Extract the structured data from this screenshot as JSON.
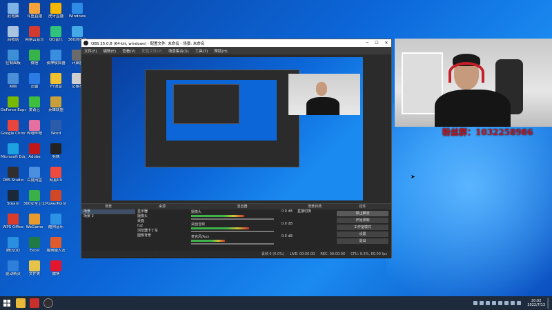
{
  "desktop_icons": [
    {
      "label": "此电脑",
      "color": "#7fb3e6",
      "col": 0,
      "row": 0
    },
    {
      "label": "回收站",
      "color": "#a9c4e0",
      "col": 0,
      "row": 1
    },
    {
      "label": "控制面板",
      "color": "#3d8fd6",
      "col": 0,
      "row": 2
    },
    {
      "label": "网络",
      "color": "#4a90d9",
      "col": 0,
      "row": 3
    },
    {
      "label": "GeForce Experience",
      "color": "#76b900",
      "col": 0,
      "row": 4
    },
    {
      "label": "Google Chrome",
      "color": "#e8453c",
      "col": 0,
      "row": 5
    },
    {
      "label": "Microsoft Edge",
      "color": "#1da1e0",
      "col": 0,
      "row": 6
    },
    {
      "label": "OBS Studio",
      "color": "#302e31",
      "col": 0,
      "row": 7
    },
    {
      "label": "Steam",
      "color": "#1b2838",
      "col": 0,
      "row": 8
    },
    {
      "label": "WPS Office",
      "color": "#d93c2a",
      "col": 0,
      "row": 9
    },
    {
      "label": "腾讯QQ",
      "color": "#2a8fe0",
      "col": 0,
      "row": 10
    },
    {
      "label": "驱动精灵",
      "color": "#2e7fd9",
      "col": 0,
      "row": 11
    },
    {
      "label": "斗鱼直播",
      "color": "#f6a23a",
      "col": 1,
      "row": 0
    },
    {
      "label": "网易云音乐",
      "color": "#d33a31",
      "col": 1,
      "row": 1
    },
    {
      "label": "微信",
      "color": "#36b44a",
      "col": 1,
      "row": 2
    },
    {
      "label": "迅雷",
      "color": "#2b7be4",
      "col": 1,
      "row": 3
    },
    {
      "label": "爱奇艺",
      "color": "#3dbf3d",
      "col": 1,
      "row": 4
    },
    {
      "label": "哔哩哔哩",
      "color": "#e56f9e",
      "col": 1,
      "row": 5
    },
    {
      "label": "Adobe",
      "color": "#c01818",
      "col": 1,
      "row": 6
    },
    {
      "label": "百度网盘",
      "color": "#4a8fe0",
      "col": 1,
      "row": 7
    },
    {
      "label": "360安全卫士",
      "color": "#3ab049",
      "col": 1,
      "row": 8
    },
    {
      "label": "WeGame",
      "color": "#e89b2c",
      "col": 1,
      "row": 9
    },
    {
      "label": "Excel",
      "color": "#1f7a45",
      "col": 1,
      "row": 10
    },
    {
      "label": "文件夹",
      "color": "#e7c34a",
      "col": 1,
      "row": 11
    },
    {
      "label": "虎牙直播",
      "color": "#f5b700",
      "col": 2,
      "row": 0
    },
    {
      "label": "QQ音乐",
      "color": "#31c27c",
      "col": 2,
      "row": 1
    },
    {
      "label": "夜神模拟器",
      "color": "#3a8ee0",
      "col": 2,
      "row": 2
    },
    {
      "label": "YY语音",
      "color": "#f2c12e",
      "col": 2,
      "row": 3
    },
    {
      "label": "英雄联盟",
      "color": "#c8a03a",
      "col": 2,
      "row": 4
    },
    {
      "label": "Word",
      "color": "#2a5caa",
      "col": 2,
      "row": 5
    },
    {
      "label": "剪映",
      "color": "#222222",
      "col": 2,
      "row": 6
    },
    {
      "label": "网易UU",
      "color": "#f04a3c",
      "col": 2,
      "row": 7
    },
    {
      "label": "PowerPoint",
      "color": "#d24726",
      "col": 2,
      "row": 8
    },
    {
      "label": "酷狗音乐",
      "color": "#2a93e6",
      "col": 2,
      "row": 9
    },
    {
      "label": "搜狗输入法",
      "color": "#e05b2c",
      "col": 2,
      "row": 10
    },
    {
      "label": "微博",
      "color": "#e6162d",
      "col": 2,
      "row": 11
    },
    {
      "label": "Windows",
      "color": "#2e8be6",
      "col": 3,
      "row": 0
    },
    {
      "label": "360浏览器",
      "color": "#44a8e6",
      "col": 3,
      "row": 1
    },
    {
      "label": "计算器",
      "color": "#6b6b6b",
      "col": 3,
      "row": 2
    },
    {
      "label": "记事本",
      "color": "#cfcfcf",
      "col": 3,
      "row": 3
    }
  ],
  "fans_text": "粉丝群：1032258986",
  "obs": {
    "title": "OBS 25.0.8 (64-bit, windows) - 配置文件: 未命名 - 场景: 未命名",
    "menu": [
      "文件(F)",
      "编辑(E)",
      "查看(V)",
      "配置文件(P)",
      "场景集合(S)",
      "工具(T)",
      "帮助(H)"
    ],
    "menu_disabled_index": 3,
    "docks": {
      "scenes": {
        "title": "场景",
        "items": [
          "场景",
          "场景 2"
        ],
        "selected": 0
      },
      "sources": {
        "title": "来源",
        "items": [
          "显示器",
          "摄像头",
          "桌面",
          "fu2",
          "浏览器卡丁车",
          "图像背景"
        ]
      },
      "mixer": {
        "title": "混音器",
        "tracks": [
          {
            "name": "摄像头",
            "db": "0.0 dB",
            "level": 0.55
          },
          {
            "name": "桌面音频",
            "db": "0.0 dB",
            "level": 0.6
          },
          {
            "name": "麦克风/Aux",
            "db": "0.0 dB",
            "level": 0.35
          }
        ]
      },
      "transitions": {
        "title": "场景转场",
        "value": "直接切换"
      },
      "controls": {
        "title": "控件",
        "buttons": [
          "停止推流",
          "开始录制",
          "工作室模式",
          "设置",
          "退出"
        ],
        "active_index": 0
      }
    },
    "status": {
      "dropped": "丢帧 0 (0.0%)",
      "live": "LIVE: 00:00:00",
      "rec": "REC: 00:00:00",
      "cpu": "CPU: 9.3%, 60.00 fps"
    }
  },
  "taskbar": {
    "time": "20:02",
    "date": "2022/7/13"
  }
}
